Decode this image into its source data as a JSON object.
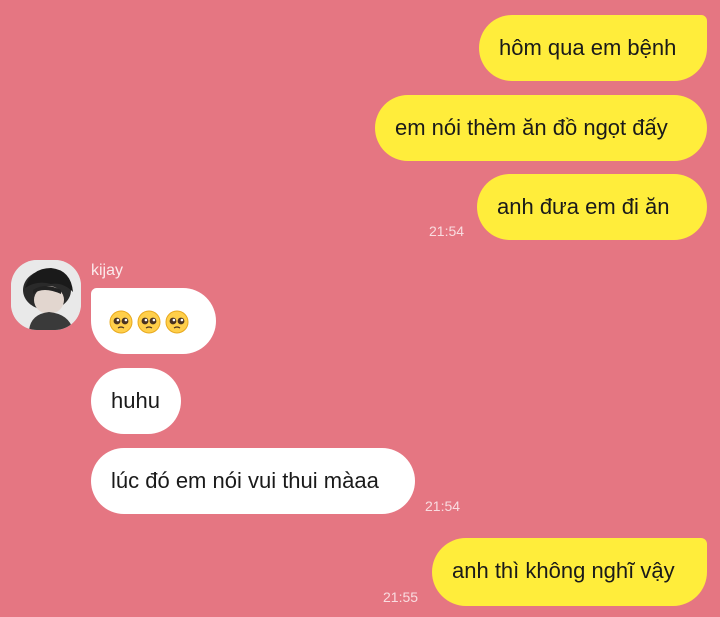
{
  "theme": {
    "background": "#e57682",
    "outgoing_bubble": "#ffed3b",
    "incoming_bubble": "#ffffff"
  },
  "messages": {
    "out1": "hôm qua em bệnh",
    "out2": "em nói thèm ăn đồ ngọt đấy",
    "out3": "anh đưa em đi ăn",
    "out3_time": "21:54",
    "sender": "kijay",
    "in1_emojis": [
      "pleading-face",
      "pleading-face",
      "pleading-face"
    ],
    "in2": "huhu",
    "in3": "lúc đó em nói vui thui màaa",
    "in3_time": "21:54",
    "out4": "anh thì không nghĩ vậy",
    "out4_time": "21:55"
  }
}
